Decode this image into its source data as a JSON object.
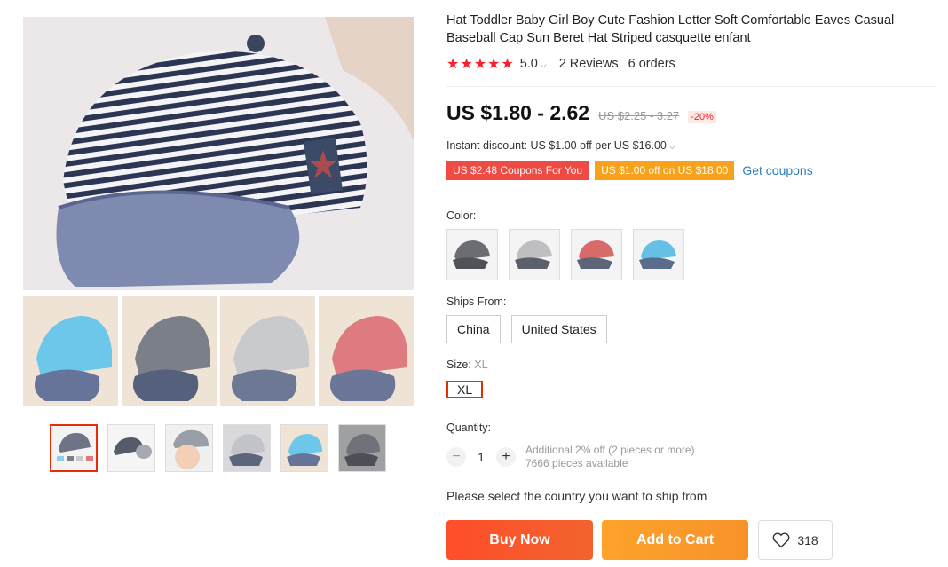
{
  "product": {
    "title": "Hat Toddler Baby Girl Boy Cute Fashion Letter Soft Comfortable Eaves Casual Baseball Cap Sun Beret Hat Striped casquette enfant",
    "rating_stars": "★★★★★",
    "rating_value": "5.0",
    "reviews": "2 Reviews",
    "orders": "6 orders"
  },
  "price": {
    "current": "US $1.80 - 2.62",
    "original": "US $2.25 - 3.27",
    "discount": "-20%",
    "instant_discount": "Instant discount: US $1.00 off per US $16.00"
  },
  "coupons": {
    "coupon1": "US $2.48 Coupons For You",
    "coupon2": "US $1.00 off on US $18.00",
    "get_coupons": "Get coupons"
  },
  "color": {
    "label": "Color:",
    "options": [
      {
        "name": "dark gray",
        "crown": "#6b6d72",
        "brim": "#4f5257"
      },
      {
        "name": "light gray",
        "crown": "#bfbfc2",
        "brim": "#5c6068"
      },
      {
        "name": "red",
        "crown": "#d96a6a",
        "brim": "#5d6478"
      },
      {
        "name": "blue",
        "crown": "#66c0e6",
        "brim": "#5b6b8a"
      }
    ]
  },
  "ships_from": {
    "label": "Ships From:",
    "options": [
      "China",
      "United States"
    ]
  },
  "size": {
    "label": "Size:",
    "selected": "XL",
    "options": [
      "XL"
    ]
  },
  "quantity": {
    "label": "Quantity:",
    "minus": "−",
    "value": "1",
    "plus": "+",
    "note1": "Additional 2% off (2 pieces or more)",
    "note2": "7666 pieces available"
  },
  "ship_message": "Please select the country you want to ship from",
  "actions": {
    "buy_now": "Buy Now",
    "add_to_cart": "Add to Cart",
    "wishlist_count": "318"
  },
  "colors": {
    "accent_red": "#e62e04",
    "buy": "#fe4d2a",
    "cart": "#fea32b",
    "link": "#2f7fb9"
  }
}
